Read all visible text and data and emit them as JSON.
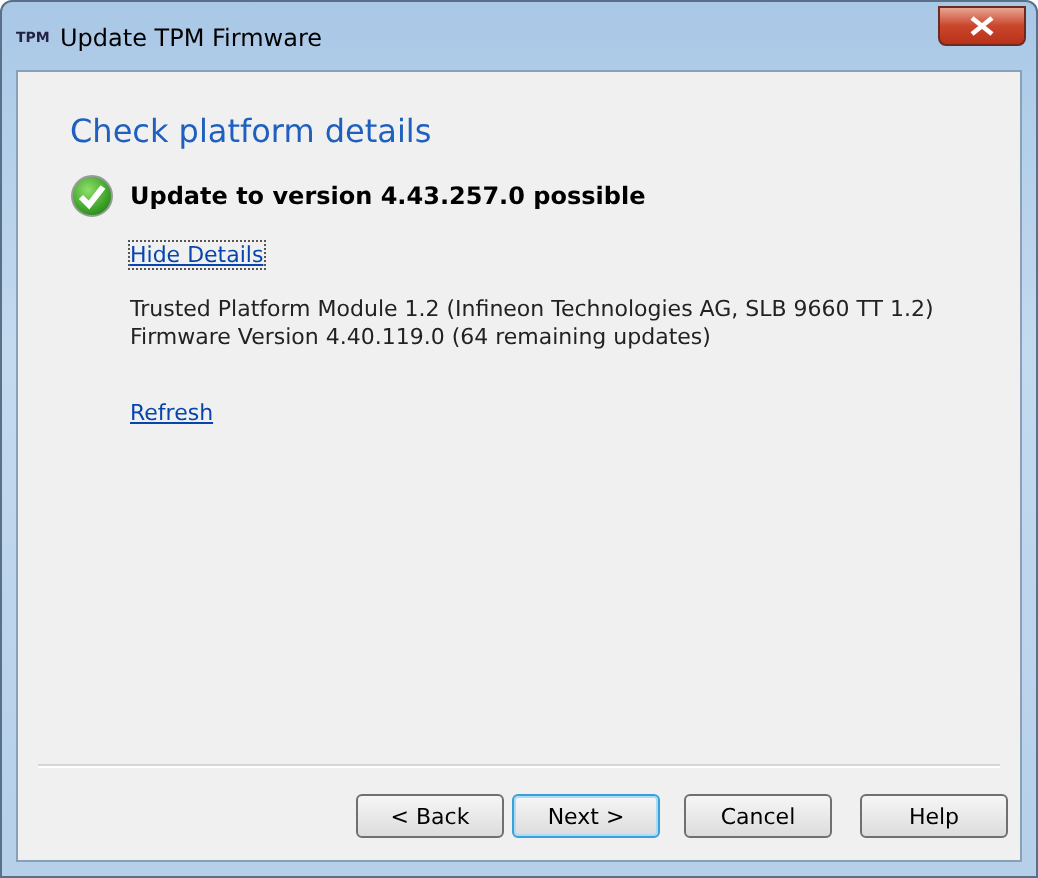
{
  "window": {
    "title": "Update TPM Firmware",
    "icon_text": "TPM"
  },
  "heading": "Check platform details",
  "status": {
    "kind": "success",
    "message": "Update to version 4.43.257.0 possible"
  },
  "details_link": "Hide Details",
  "details": [
    "Trusted Platform Module 1.2 (Infineon Technologies AG, SLB 9660 TT 1.2)",
    "Firmware Version 4.40.119.0 (64 remaining updates)"
  ],
  "refresh_link": "Refresh",
  "buttons": [
    {
      "label": "< Back",
      "default": false
    },
    {
      "label": "Next >",
      "default": true
    },
    {
      "label": "Cancel",
      "default": false
    },
    {
      "label": "Help",
      "default": false
    }
  ]
}
